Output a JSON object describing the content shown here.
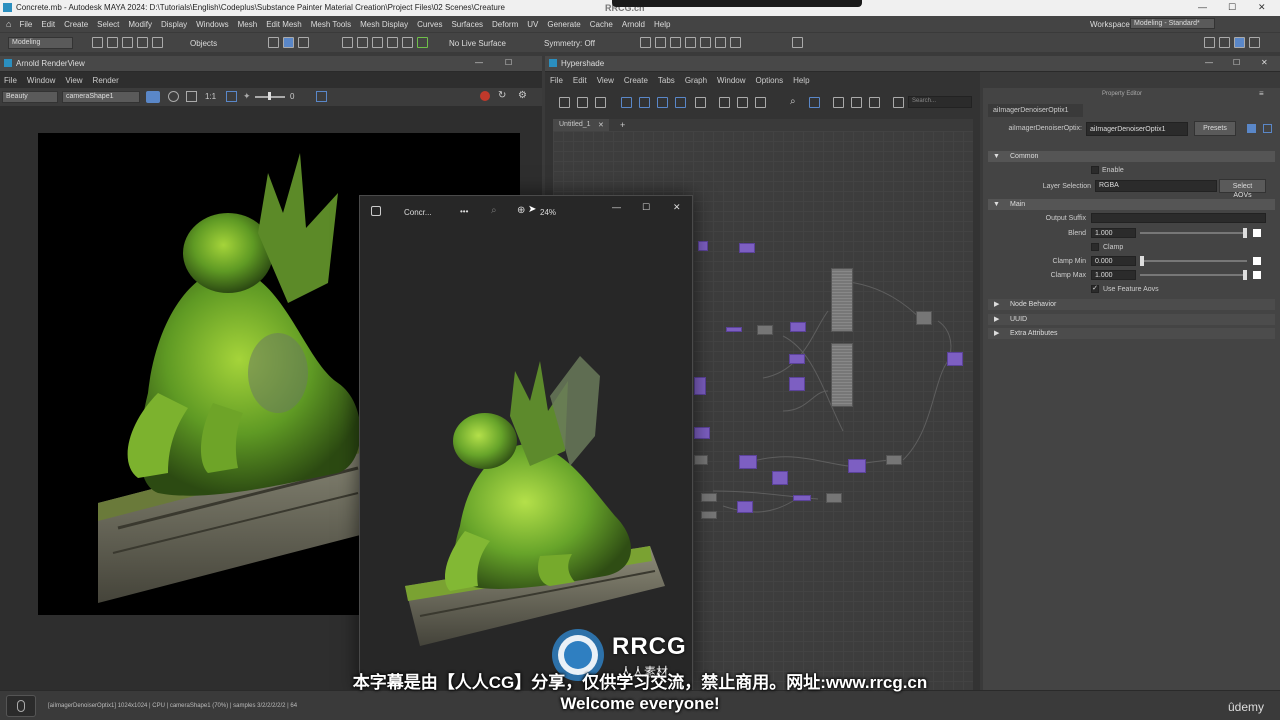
{
  "window": {
    "title": "Concrete.mb - Autodesk MAYA 2024: D:\\Tutorials\\English\\Codeplus\\Substance Painter Material Creation\\Project Files\\02 Scenes\\Creature"
  },
  "menubar": {
    "items": [
      "File",
      "Edit",
      "Create",
      "Select",
      "Modify",
      "Display",
      "Windows",
      "Mesh",
      "Edit Mesh",
      "Mesh Tools",
      "Mesh Display",
      "Curves",
      "Surfaces",
      "Deform",
      "UV",
      "Generate",
      "Cache",
      "Arnold",
      "Help"
    ],
    "workspace_label": "Workspace:",
    "workspace_value": "Modeling - Standard*"
  },
  "shelf": {
    "mode": "Modeling",
    "objects_label": "Objects",
    "live_surface": "No Live Surface",
    "symmetry": "Symmetry: Off"
  },
  "render_view": {
    "title": "Arnold RenderView",
    "menu": [
      "File",
      "Window",
      "View",
      "Render"
    ],
    "aov": "Beauty",
    "camera": "cameraShape1",
    "ratio": "1:1",
    "exposure": "0"
  },
  "photo_viewer": {
    "title": "Concr...",
    "more": "•••",
    "zoom": "24%"
  },
  "hypershade": {
    "title": "Hypershade",
    "menu": [
      "File",
      "Edit",
      "View",
      "Create",
      "Tabs",
      "Graph",
      "Window",
      "Options",
      "Help"
    ],
    "search_placeholder": "Search...",
    "tab": "Untitled_1",
    "tab_add": "+"
  },
  "property_editor": {
    "title": "Property Editor",
    "node_tab": "aiImagerDenoiserOptix1",
    "node_label": "aiImagerDenoiserOptix:",
    "node_value": "aiImagerDenoiserOptix1",
    "presets": "Presets",
    "sections": {
      "common": "Common",
      "main": "Main",
      "node_behavior": "Node Behavior",
      "uuid": "UUID",
      "extra": "Extra Attributes"
    },
    "enable_label": "Enable",
    "layer_selection_label": "Layer Selection",
    "layer_selection_value": "RGBA",
    "select_aovs": "Select AOVs",
    "output_suffix_label": "Output Suffix",
    "output_suffix_value": "",
    "blend_label": "Blend",
    "blend_value": "1.000",
    "clamp_label": "Clamp",
    "clamp_min_label": "Clamp Min",
    "clamp_min_value": "0.000",
    "clamp_max_label": "Clamp Max",
    "clamp_max_value": "1.000",
    "use_feature_aovs_label": "Use Feature Aovs"
  },
  "status": {
    "text": "[aiImagerDenoiserOptix1]  1024x1024 | CPU | cameraShape1 (70%) | samples 3/2/2/2/2/2 | 64"
  },
  "subtitles": {
    "cn": "本字幕是由【人人CG】分享，仅供学习交流，禁止商用。网址:www.rrcg.cn",
    "en": "Welcome everyone!"
  },
  "watermark": {
    "logo_text": "RRCG",
    "logo_sub": "人人素材",
    "top_text": "RRCG.cn"
  },
  "branding": {
    "udemy": "ûdemy"
  },
  "colors": {
    "accent": "#5a87c8",
    "node_purple": "#7d5fc2",
    "moss_green": "#6aa82a"
  }
}
